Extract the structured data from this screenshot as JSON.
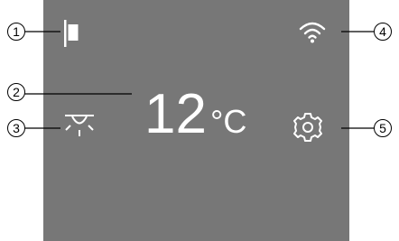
{
  "display": {
    "temperature_value": "12",
    "temperature_unit": "°C"
  },
  "icons": {
    "top_left": "door-flag-icon",
    "top_right": "wifi-icon",
    "left_middle": "light-icon",
    "right_middle": "settings-gear-icon"
  },
  "callouts": [
    "1",
    "2",
    "3",
    "4",
    "5"
  ],
  "colors": {
    "screen": "#777777",
    "foreground": "#ffffff"
  }
}
